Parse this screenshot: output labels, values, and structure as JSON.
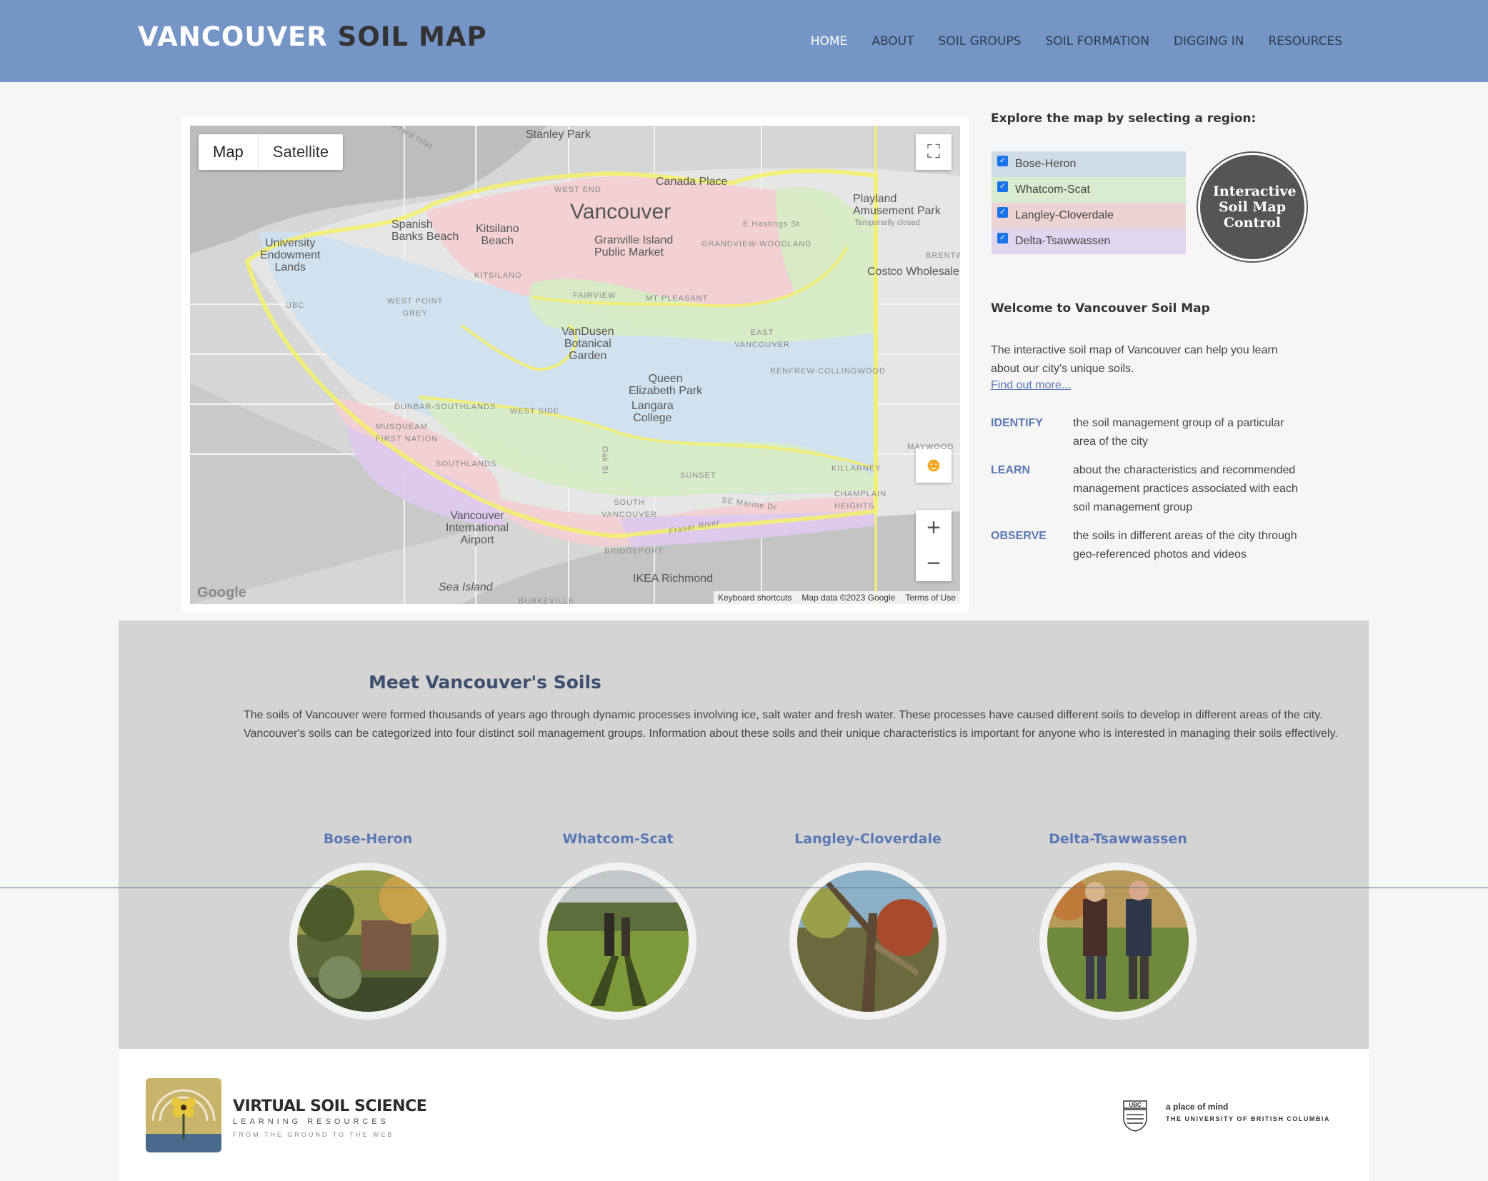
{
  "header": {
    "logo_part1": "VANCOUVER",
    "logo_part2": "SOIL MAP",
    "nav": [
      "HOME",
      "ABOUT",
      "SOIL GROUPS",
      "SOIL FORMATION",
      "DIGGING IN",
      "RESOURCES"
    ]
  },
  "map": {
    "toggle_map": "Map",
    "toggle_satellite": "Satellite",
    "attribution": [
      "Keyboard shortcuts",
      "Map data ©2023 Google",
      "Terms of Use"
    ],
    "google": "Google",
    "labels": {
      "stanley_park": "Stanley Park",
      "canada_place": "Canada Place",
      "vancouver": "Vancouver",
      "playland": "Playland\nAmusement Park",
      "playland_note": "Temporarily closed",
      "granville": "Granville Island\nPublic Market",
      "spanish_banks": "Spanish\nBanks Beach",
      "kitsilano_beach": "Kitsilano\nBeach",
      "university": "University\nEndowment\nLands",
      "costco": "Costco Wholesale",
      "vandusen": "VanDusen\nBotanical\nGarden",
      "queen_elizabeth": "Queen\nElizabeth Park",
      "langara": "Langara\nCollege",
      "airport": "Vancouver\nInternational\nAirport",
      "sea_island": "Sea Island",
      "ikea": "IKEA Richmond",
      "bridgeport": "BRIDGEPORT",
      "burkeville": "BURKEVILLE",
      "kitsilano": "KITSILANO",
      "west_point_grey": "WEST POINT\nGREY",
      "ubc": "UBC",
      "fairview": "FAIRVIEW",
      "mt_pleasant": "MT PLEASANT",
      "grandview": "GRANDVIEW-WOODLAND",
      "east_vancouver": "EAST\nVANCOUVER",
      "renfrew": "RENFREW-COLLINGWOOD",
      "dunbar": "DUNBAR-SOUTHLANDS",
      "west_side": "WEST SIDE",
      "musqueam": "MUSQUEAM\nFIRST NATION",
      "southlands": "SOUTHLANDS",
      "sunset": "SUNSET",
      "killarney": "KILLARNEY",
      "south_vancouver": "SOUTH\nVANCOUVER",
      "champlain": "CHAMPLAIN\nHEIGHTS",
      "west_end": "WEST END",
      "fraser_river": "Fraser River",
      "oak_st": "Oak St",
      "se_marine": "SE Marine Dr",
      "e_hastings": "E Hastings St",
      "brent": "BRENTW",
      "maywood": "MAYWOOD",
      "burrard_inlet": "Burrard Inlet"
    }
  },
  "explore": {
    "title": "Explore the map by selecting a region:",
    "regions": [
      {
        "label": "Bose-Heron",
        "color": "#cfdbe7"
      },
      {
        "label": "Whatcom-Scat",
        "color": "#d9ecd0"
      },
      {
        "label": "Langley-Cloverdale",
        "color": "#eed3d5"
      },
      {
        "label": "Delta-Tsawwassen",
        "color": "#e1d6ef"
      }
    ],
    "control": "Interactive Soil Map Control"
  },
  "welcome": {
    "title": "Welcome to Vancouver Soil Map",
    "text": "The interactive soil map of Vancouver can help you learn about our city's unique soils.",
    "link": "Find out more...",
    "features": [
      {
        "key": "IDENTIFY",
        "value": "the soil management group of a particular area of the city"
      },
      {
        "key": "LEARN",
        "value": "about the characteristics and recommended management practices associated with each soil management group"
      },
      {
        "key": "OBSERVE",
        "value": "the soils in different areas of the city through geo-referenced photos and videos"
      }
    ]
  },
  "soils": {
    "title": "Meet Vancouver's Soils",
    "text": "The soils of Vancouver were formed thousands of years ago through dynamic processes involving ice, salt water and fresh water. These processes have caused different soils to develop in different areas of the city. Vancouver's soils can be categorized into four distinct soil management groups. Information about these soils and their unique characteristics is important for anyone who is interested in managing their soils effectively.",
    "groups": [
      "Bose-Heron",
      "Whatcom-Scat",
      "Langley-Cloverdale",
      "Delta-Tsawwassen"
    ]
  },
  "footer": {
    "vss_title": "VIRTUAL SOIL SCIENCE",
    "vss_sub": "LEARNING RESOURCES",
    "vss_tag": "FROM THE GROUND TO THE WEB",
    "ubc_t1": "a place of mind",
    "ubc_t2": "THE UNIVERSITY OF BRITISH COLUMBIA",
    "ubc_crest": "UBC"
  }
}
